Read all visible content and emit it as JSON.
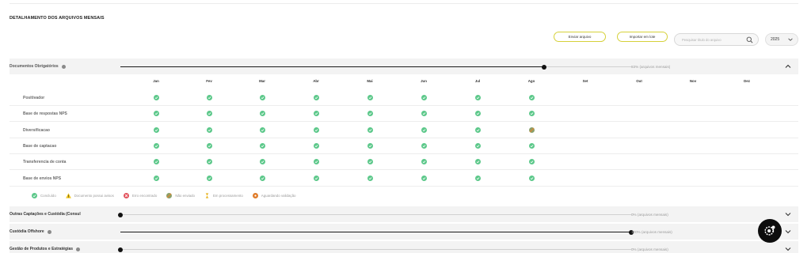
{
  "page": {
    "section_title": "DETALHAMENTO DOS ARQUIVOS MENSAIS"
  },
  "toolbar": {
    "send_label": "Enviar arquivo",
    "import_label": "Importar em lote",
    "search_placeholder": "Pesquisar título do arquivo",
    "year": "2025"
  },
  "months": [
    "Jan",
    "Fev",
    "Mar",
    "Abr",
    "Mai",
    "Jun",
    "Jul",
    "Ago",
    "Set",
    "Out",
    "Nov",
    "Dez"
  ],
  "sections": [
    {
      "title": "Documentos Obrigatórios",
      "progress_fraction": 0.83,
      "progress_label": "83% (arquivos mensais)",
      "expanded": true,
      "has_info": true
    },
    {
      "title": "Outras Captações e Custódia (Consul",
      "progress_fraction": 0.0,
      "progress_label": "0% (arquivos mensais)",
      "expanded": false,
      "has_info": false
    },
    {
      "title": "Custódia Offshore",
      "progress_fraction": 1.0,
      "progress_label": "100% (arquivos mensais)",
      "expanded": false,
      "has_info": true
    },
    {
      "title": "Gestão de Produtos e Estratégias",
      "progress_fraction": 0.0,
      "progress_label": "0% (arquivos mensais)",
      "expanded": false,
      "has_info": true
    }
  ],
  "documents": [
    {
      "label": "Positivador",
      "status": [
        "ok",
        "ok",
        "ok",
        "ok",
        "ok",
        "ok",
        "ok",
        "ok",
        "",
        "",
        "",
        ""
      ]
    },
    {
      "label": "Base de respostas NPS",
      "status": [
        "ok",
        "ok",
        "ok",
        "ok",
        "ok",
        "ok",
        "ok",
        "ok",
        "",
        "",
        "",
        ""
      ]
    },
    {
      "label": "Diversificacao",
      "status": [
        "ok",
        "ok",
        "ok",
        "ok",
        "ok",
        "ok",
        "ok",
        "not_sent",
        "",
        "",
        "",
        ""
      ]
    },
    {
      "label": "Base de captacao",
      "status": [
        "ok",
        "ok",
        "ok",
        "ok",
        "ok",
        "ok",
        "ok",
        "ok",
        "",
        "",
        "",
        ""
      ]
    },
    {
      "label": "Transferencia de conta",
      "status": [
        "ok",
        "ok",
        "ok",
        "ok",
        "ok",
        "ok",
        "ok",
        "ok",
        "",
        "",
        "",
        ""
      ]
    },
    {
      "label": "Base de envios NPS",
      "status": [
        "ok",
        "ok",
        "ok",
        "ok",
        "ok",
        "ok",
        "ok",
        "ok",
        "",
        "",
        "",
        ""
      ]
    }
  ],
  "legend": [
    {
      "key": "ok",
      "label": "Concluído",
      "icon": "check-circle-icon"
    },
    {
      "key": "warning",
      "label": "Documento possui avisos",
      "icon": "warning-triangle-icon"
    },
    {
      "key": "error",
      "label": "Erro encontrado",
      "icon": "error-circle-icon"
    },
    {
      "key": "not_sent",
      "label": "Não enviado",
      "icon": "not-sent-icon"
    },
    {
      "key": "processing",
      "label": "Em processamento",
      "icon": "hourglass-icon"
    },
    {
      "key": "pending",
      "label": "Aguardando validação",
      "icon": "pending-circle-icon"
    }
  ],
  "colors": {
    "ok": "#5cc88a",
    "warning": "#f0c419",
    "error": "#e2525c",
    "not_sent": "#8aa06a",
    "processing": "#e8b420",
    "pending": "#e07c2a",
    "button_border": "#d6d13a"
  }
}
